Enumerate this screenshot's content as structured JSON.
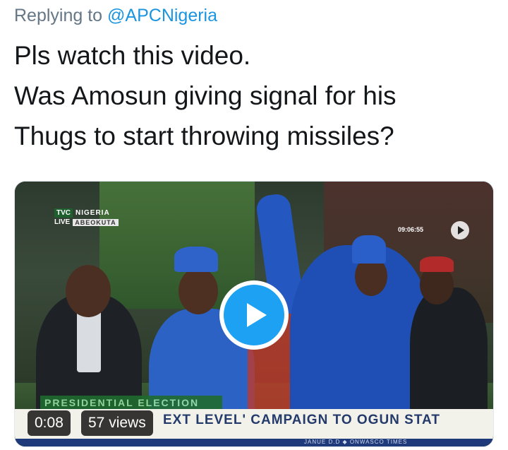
{
  "tweet": {
    "replying_prefix": "Replying to",
    "replying_handle": "@APCNigeria",
    "lines": [
      "Pls watch this video.",
      "Was Amosun giving signal for his",
      "Thugs to start throwing missiles?"
    ]
  },
  "video": {
    "duration": "0:08",
    "views": "57 views",
    "overlay": {
      "channel": "TVC",
      "region": "NIGERIA",
      "live": "LIVE",
      "city": "ABEOKUTA",
      "clock": "09:06:55",
      "label": "PRESIDENTIAL ELECTION",
      "ticker": "EXT LEVEL' CAMPAIGN TO OGUN STAT",
      "sub_ticker": "JANUE D.D   ◆   ONWASCO  TIMES"
    }
  },
  "colors": {
    "link": "#1b95e0",
    "play_button": "#1da1f2",
    "text": "#14171a",
    "muted": "#657786"
  },
  "icons": {
    "play": "play-icon"
  }
}
